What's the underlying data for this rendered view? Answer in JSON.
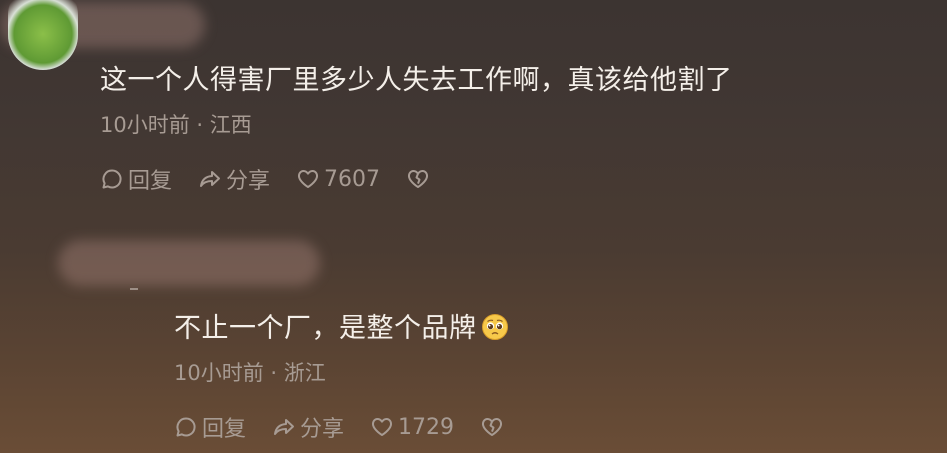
{
  "comments": [
    {
      "text": "这一个人得害厂里多少人失去工作啊，真该给他割了",
      "meta": "10小时前 · 江西",
      "reply_label": "回复",
      "share_label": "分享",
      "likes": "7607"
    },
    {
      "text": "不止一个厂，是整个品牌",
      "emoji": "pleading-face",
      "meta": "10小时前 · 浙江",
      "reply_label": "回复",
      "share_label": "分享",
      "likes": "1729"
    }
  ],
  "colors": {
    "text": "#f4efe9",
    "meta": "#a79b93"
  },
  "icons": [
    "comment-bubble-icon",
    "share-arrow-icon",
    "heart-icon",
    "broken-heart-icon",
    "pleading-face-emoji"
  ]
}
